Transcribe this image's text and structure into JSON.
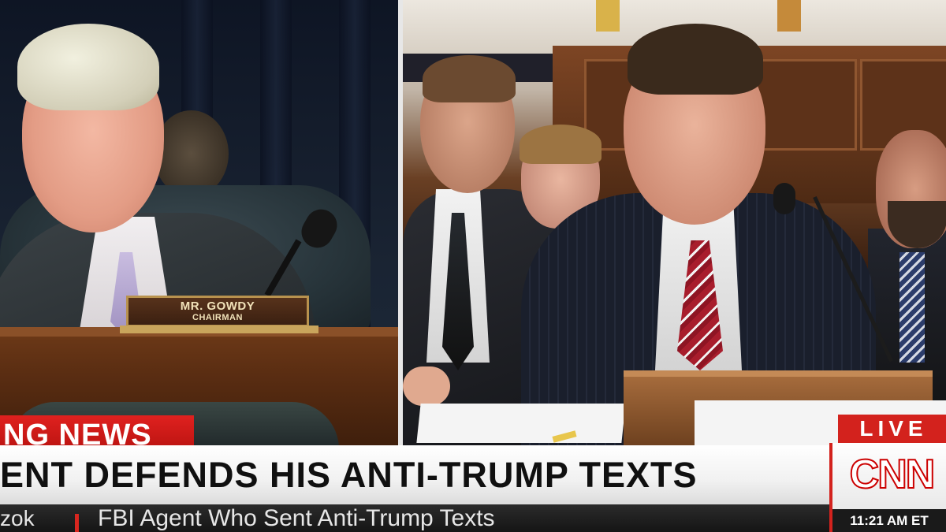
{
  "left_panel": {
    "nameplate": {
      "name": "MR. GOWDY",
      "title": "CHAIRMAN"
    }
  },
  "lower_third": {
    "breaking_label": "NG NEWS",
    "headline": "ENT DEFENDS HIS ANTI-TRUMP TEXTS",
    "ticker_name": "zok",
    "ticker_text": "FBI Agent Who Sent Anti-Trump Texts"
  },
  "network": {
    "live_label": "LIVE",
    "logo_text": "CNN",
    "time": "11:21 AM ET"
  },
  "colors": {
    "brand_red": "#d3221d",
    "headline_bg": "#f1f1f1",
    "ticker_bg": "#151515"
  }
}
